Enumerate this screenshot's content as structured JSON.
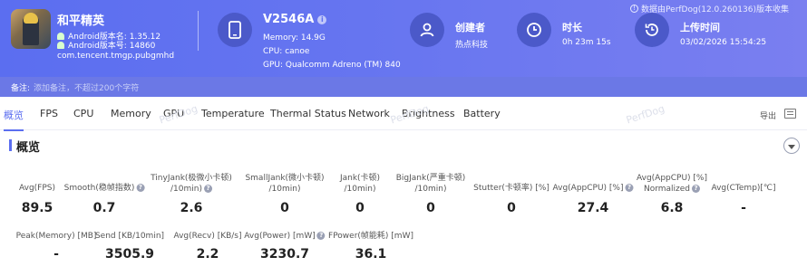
{
  "header": {
    "source_note": "数据由PerfDog(12.0.260136)版本收集",
    "app": {
      "name": "和平精英",
      "android_version": "Android版本名: 1.35.12",
      "android_code": "Android版本号: 14860",
      "package": "com.tencent.tmgp.pubgmhd"
    },
    "device": {
      "name": "V2546A",
      "memory": "Memory: 14.9G",
      "cpu": "CPU: canoe",
      "gpu": "GPU: Qualcomm Adreno (TM) 840"
    },
    "creator": {
      "title": "创建者",
      "value": "热点科技"
    },
    "duration": {
      "title": "时长",
      "value": "0h 23m 15s"
    },
    "upload": {
      "title": "上传时间",
      "value": "03/02/2026 15:54:25"
    }
  },
  "notes": {
    "label": "备注:",
    "placeholder": "添加备注，不超过200个字符"
  },
  "tabs": [
    "概览",
    "FPS",
    "CPU",
    "Memory",
    "GPU",
    "Temperature",
    "Thermal Status",
    "Network",
    "Brightness",
    "Battery"
  ],
  "export_label": "导出",
  "watermark": "PerfDog",
  "overview": {
    "title": "概览",
    "row1": [
      {
        "label1": "Avg(FPS)",
        "label2": "",
        "help": false,
        "value": "89.5"
      },
      {
        "label1": "Smooth(稳帧指数)",
        "label2": "",
        "help": true,
        "value": "0.7"
      },
      {
        "label1": "TinyJank(极微小卡顿)",
        "label2": "/10min)",
        "help": true,
        "value": "2.6"
      },
      {
        "label1": "SmallJank(微小卡顿)",
        "label2": "/10min)",
        "help": false,
        "value": "0"
      },
      {
        "label1": "Jank(卡顿)",
        "label2": "/10min)",
        "help": false,
        "value": "0"
      },
      {
        "label1": "BigJank(严重卡顿)",
        "label2": "/10min)",
        "help": false,
        "value": "0"
      },
      {
        "label1": "Stutter(卡顿率) [%]",
        "label2": "",
        "help": false,
        "value": "0"
      },
      {
        "label1": "Avg(AppCPU) [%]",
        "label2": "",
        "help": true,
        "value": "27.4"
      },
      {
        "label1": "Avg(AppCPU) [%]",
        "label2": "Normalized",
        "help": true,
        "value": "6.8"
      },
      {
        "label1": "Avg(CTemp)[℃]",
        "label2": "",
        "help": false,
        "value": "-"
      }
    ],
    "row2": [
      {
        "label1": "Peak(Memory) [MB]",
        "label2": "",
        "help": false,
        "value": "-"
      },
      {
        "label1": "Send [KB/10min]",
        "label2": "",
        "help": false,
        "value": "3505.9"
      },
      {
        "label1": "Avg(Recv) [KB/s]",
        "label2": "",
        "help": false,
        "value": "2.2"
      },
      {
        "label1": "Avg(Power) [mW]",
        "label2": "",
        "help": true,
        "value": "3230.7"
      },
      {
        "label1": "FPower(帧能耗) [mW]",
        "label2": "",
        "help": false,
        "value": "36.1"
      }
    ]
  },
  "colors": {
    "accent": "#5b6ef0",
    "header": "#6675f0"
  }
}
